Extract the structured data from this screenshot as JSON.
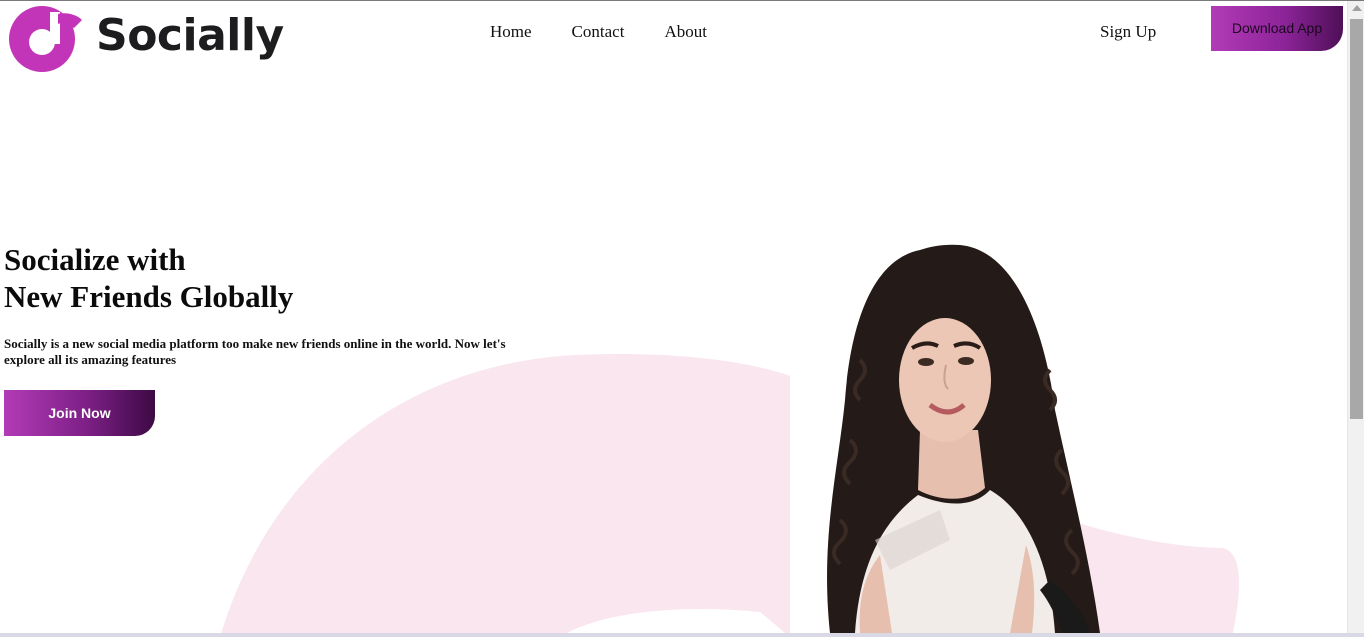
{
  "header": {
    "brand": "Socially",
    "nav": [
      "Home",
      "Contact",
      "About"
    ],
    "signup_label": "Sign Up",
    "download_label": "Download App"
  },
  "hero": {
    "title_line1": "Socialize with",
    "title_line2": "New Friends Globally",
    "description": "Socially is a new social media platform too make new friends online in the world. Now let's explore all its amazing features",
    "join_label": "Join Now"
  },
  "colors": {
    "accent_start": "#b23bb6",
    "accent_end": "#4e0f57",
    "background_shape": "#fae6ef"
  },
  "icons": [
    "socially-logo-icon",
    "scroll-up-icon"
  ]
}
